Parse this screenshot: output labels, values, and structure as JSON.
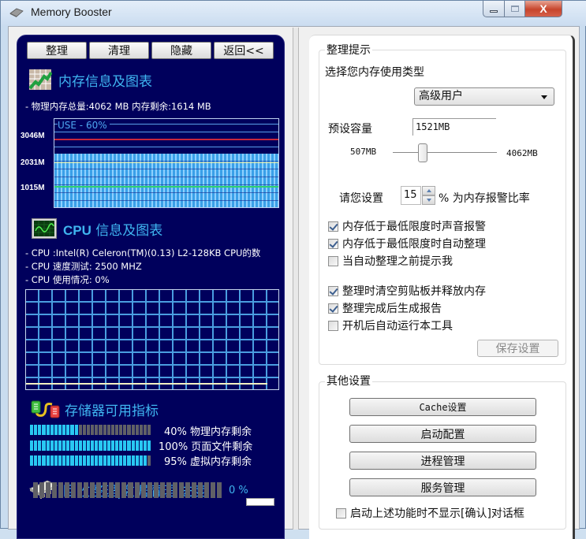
{
  "window": {
    "title": "Memory Booster",
    "controls": [
      "minimize",
      "maximize",
      "close"
    ]
  },
  "toolbar": {
    "buttons": [
      "整理",
      "清理",
      "隐藏",
      "返回<<"
    ]
  },
  "memory_section": {
    "title": "内存信息及图表",
    "info": "- 物理内存总量:4062 MB  内存剩余:1614 MB",
    "chart": {
      "use_label": "USE - 60%",
      "usage_percent": 60,
      "y_labels": [
        "3046M",
        "2031M",
        "1015M"
      ],
      "line_colors": {
        "upper": "#c8283c",
        "mid": "#e8e8a0",
        "lower": "#30d070"
      }
    }
  },
  "cpu_section": {
    "title_bold": "CPU",
    "title": " 信息及图表",
    "info": [
      "- CPU :Intel(R) Celeron(TM)(0.13) L2-128KB CPU的数",
      "- CPU 速度测试: 2500 MHZ",
      "- CPU 使用情况:  0%"
    ],
    "usage_percent": 0
  },
  "storage_section": {
    "title": "存储器可用指标",
    "bars": [
      {
        "label": "40% 物理内存剩余",
        "percent": 40
      },
      {
        "label": "100% 页面文件剩余",
        "percent": 100
      },
      {
        "label": "95% 虚拟内存剩余",
        "percent": 95
      }
    ]
  },
  "progress_section": {
    "title": "回收整理|数据清理 进度",
    "percent": 0,
    "label": "0 %"
  },
  "tips_group": {
    "title": "整理提示",
    "select_type_label": "选择您内存使用类型",
    "user_type": "高级用户",
    "preset_label": "预设容量",
    "preset_value": "1521MB",
    "slider_min": "507MB",
    "slider_max": "4062MB",
    "slider_value_mb": 1521,
    "alarm_prefix": "请您设置",
    "alarm_value": "15",
    "alarm_suffix": "% 为内存报警比率",
    "checkboxes": [
      {
        "label": "内存低于最低限度时声音报警",
        "checked": true
      },
      {
        "label": "内存低于最低限度时自动整理",
        "checked": true
      },
      {
        "label": "当自动整理之前提示我",
        "checked": false
      },
      {
        "label": "整理时清空剪贴板并释放内存",
        "checked": true
      },
      {
        "label": "整理完成后生成报告",
        "checked": true
      },
      {
        "label": "开机后自动运行本工具",
        "checked": false
      }
    ],
    "save_button": "保存设置"
  },
  "other_group": {
    "title": "其他设置",
    "buttons": [
      "Cache设置",
      "启动配置",
      "进程管理",
      "服务管理"
    ],
    "confirm_checkbox": {
      "label": "启动上述功能时不显示[确认]对话框",
      "checked": false
    }
  }
}
